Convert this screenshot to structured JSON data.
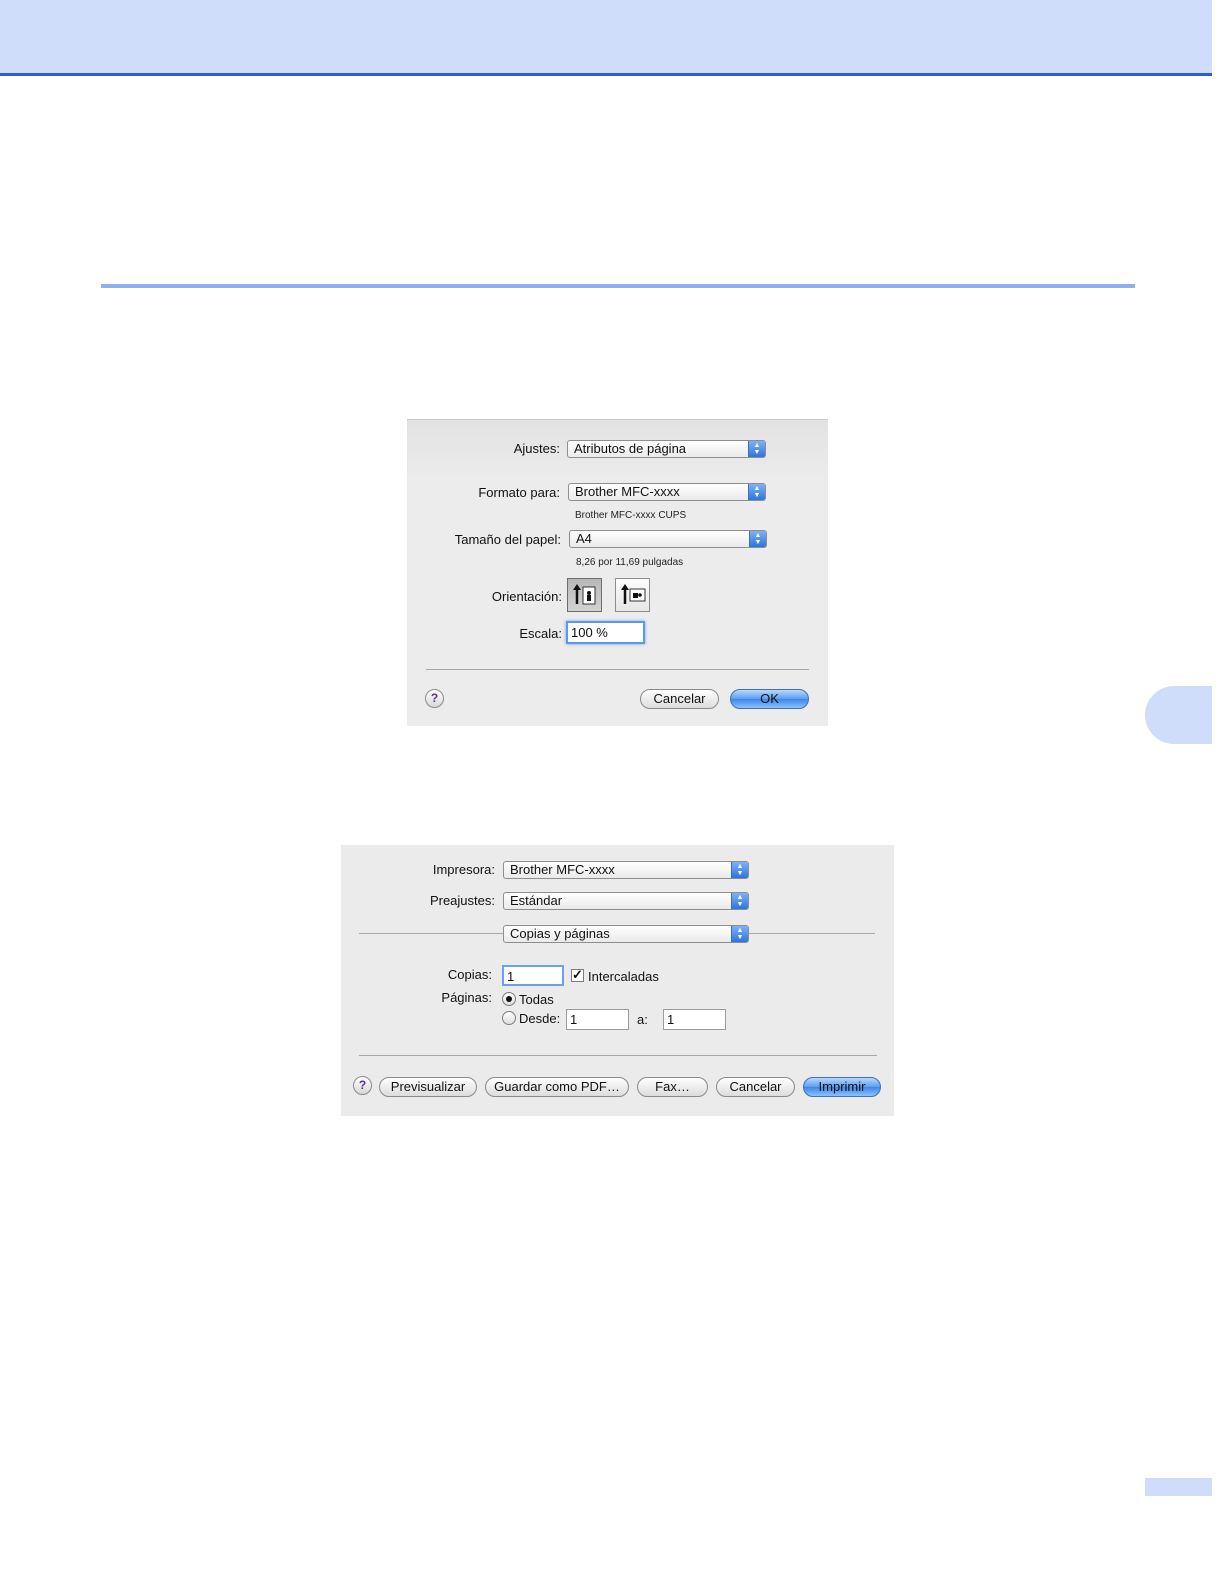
{
  "page_setup": {
    "ajustes_label": "Ajustes:",
    "ajustes_value": "Atributos de página",
    "formato_label": "Formato para:",
    "formato_value": "Brother MFC-xxxx",
    "formato_detail": "Brother MFC-xxxx CUPS",
    "tamano_label": "Tamaño del papel:",
    "tamano_value": "A4",
    "tamano_detail": "8,26 por 11,69 pulgadas",
    "orientacion_label": "Orientación:",
    "orientacion_selected": "portrait",
    "escala_label": "Escala:",
    "escala_value": "100 %",
    "help_glyph": "?",
    "cancel_label": "Cancelar",
    "ok_label": "OK"
  },
  "print": {
    "impresora_label": "Impresora:",
    "impresora_value": "Brother MFC-xxxx",
    "preajustes_label": "Preajustes:",
    "preajustes_value": "Estándar",
    "panel_value": "Copias y páginas",
    "copias_label": "Copias:",
    "copias_value": "1",
    "intercaladas_label": "Intercaladas",
    "intercaladas_checked": true,
    "paginas_label": "Páginas:",
    "todas_label": "Todas",
    "todas_selected": true,
    "desde_label": "Desde:",
    "desde_value": "1",
    "a_label": "a:",
    "a_value": "1",
    "help_glyph": "?",
    "preview_label": "Previsualizar",
    "pdf_label": "Guardar como PDF…",
    "fax_label": "Fax…",
    "cancel_label": "Cancelar",
    "print_label": "Imprimir"
  },
  "colors": {
    "band": "#cfddfb",
    "band_border": "#2d5fd2",
    "rule": "#8fb0ef",
    "default_button": "#3b86ec"
  }
}
